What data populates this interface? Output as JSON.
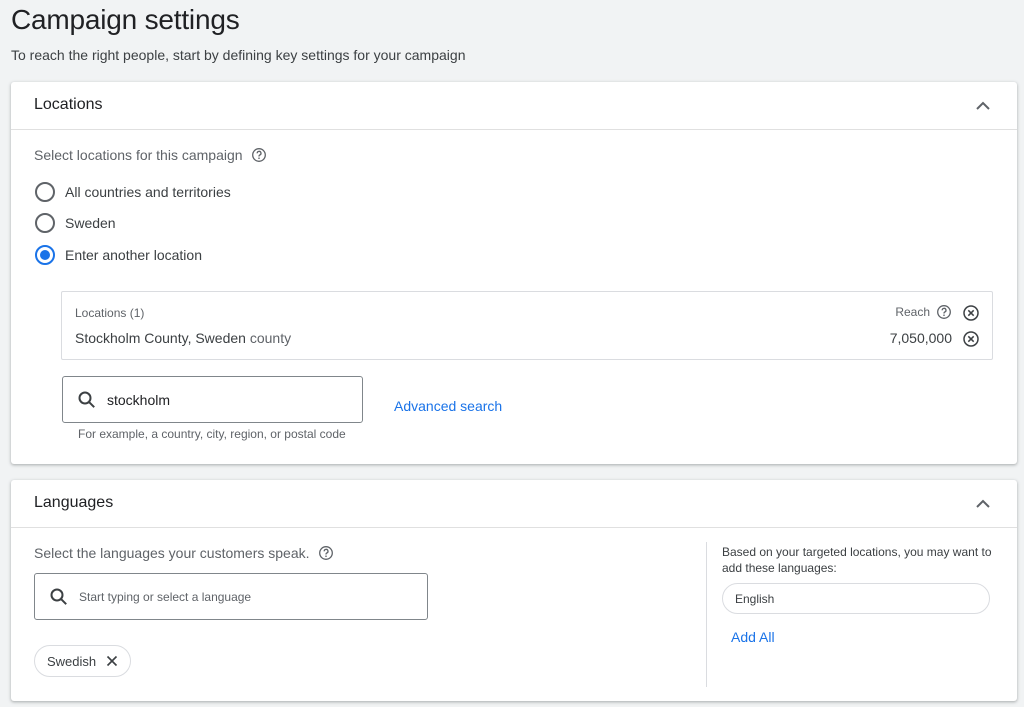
{
  "page": {
    "title": "Campaign settings",
    "subtitle": "To reach the right people, start by defining key settings for your campaign"
  },
  "locations": {
    "title": "Locations",
    "select_label": "Select locations for this campaign",
    "options": [
      {
        "label": "All countries and territories",
        "checked": false
      },
      {
        "label": "Sweden",
        "checked": false
      },
      {
        "label": "Enter another location",
        "checked": true
      }
    ],
    "list_header": "Locations (1)",
    "reach_label": "Reach",
    "item": {
      "name": "Stockholm County, Sweden",
      "type": "county",
      "reach": "7,050,000"
    },
    "search_value": "stockholm",
    "search_hint": "For example, a country, city, region, or postal code",
    "advanced_search": "Advanced search"
  },
  "languages": {
    "title": "Languages",
    "select_label": "Select the languages your customers speak.",
    "search_placeholder": "Start typing or select a language",
    "selected_chip": "Swedish",
    "suggest_text": "Based on your targeted locations, you may want to add these languages:",
    "suggested_chip": "English",
    "add_all": "Add All"
  },
  "colors": {
    "accent": "#1a73e8",
    "background": "#f1f3f4",
    "card": "#ffffff"
  },
  "icons": {
    "collapse": "chevron-up-icon",
    "help": "help-circle-icon",
    "remove": "close-circle-icon",
    "search": "search-icon",
    "chip_remove": "close-icon"
  }
}
